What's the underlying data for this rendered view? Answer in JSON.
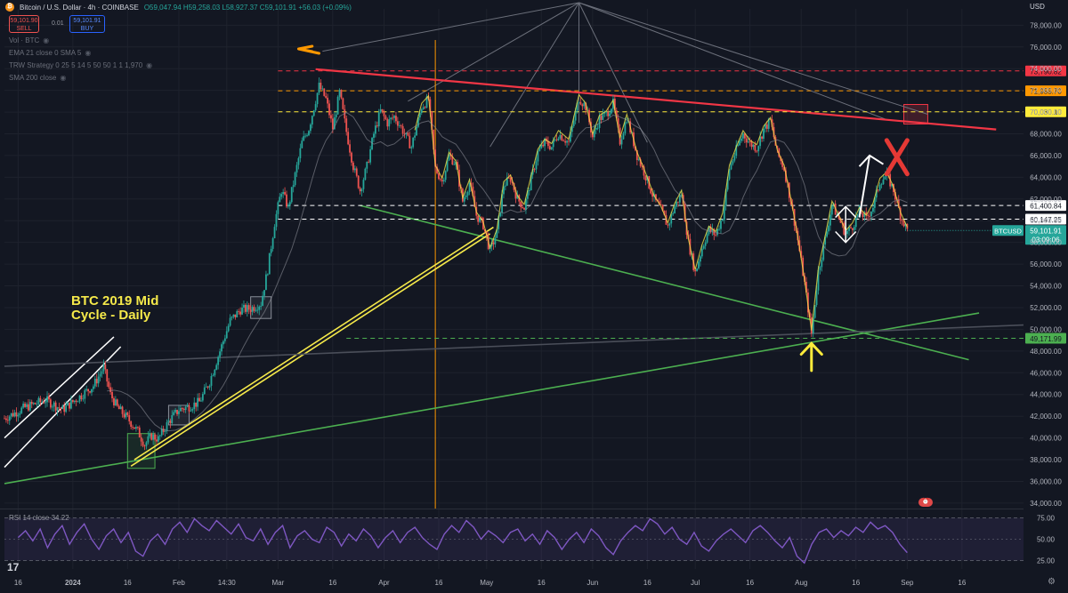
{
  "header": {
    "symbol_title": "Bitcoin / U.S. Dollar · 4h · COINBASE",
    "ohlc": {
      "o": "O59,047.94",
      "h": "H59,258.03",
      "l": "L58,927.37",
      "c": "C59,101.91",
      "chg": "+56.03 (+0.09%)"
    },
    "sell_price": "59,101.90",
    "sell_label": "SELL",
    "buy_price": "59,101.91",
    "buy_label": "BUY",
    "spread": "0.01",
    "currency": "USD"
  },
  "indicators": [
    "Vol · BTC",
    "EMA 21 close 0 SMA 5",
    "TRW Strategy 0 25 5 14 5 50 50 1 1 1,970",
    "SMA 200 close"
  ],
  "annotation": {
    "line1": "BTC 2019 Mid",
    "line2": "Cycle - Daily"
  },
  "rsi_label": "RSI 14 close 34.22",
  "tv_logo": "17",
  "colors": {
    "background": "#131722",
    "up": "#26a69a",
    "down": "#ef5350",
    "red_level": "#f23645",
    "orange_level": "#ff9800",
    "yellow_level": "#ffeb3b",
    "green_trend": "#4caf50",
    "yellow_trend": "#f5e94a",
    "rsi": "#7e57c2"
  },
  "chart_data": {
    "type": "candlestick",
    "price_axis": {
      "ticks": [
        34000,
        36000,
        38000,
        40000,
        42000,
        44000,
        46000,
        48000,
        50000,
        52000,
        54000,
        56000,
        58000,
        60000,
        62000,
        64000,
        66000,
        68000,
        70000,
        72000,
        74000,
        76000,
        78000
      ],
      "tick_labels": [
        "34,000.00",
        "36,000.00",
        "38,000.00",
        "40,000.00",
        "42,000.00",
        "44,000.00",
        "46,000.00",
        "48,000.00",
        "50,000.00",
        "52,000.00",
        "54,000.00",
        "56,000.00",
        "58,000.00",
        "60,000.00",
        "62,000.00",
        "64,000.00",
        "66,000.00",
        "68,000.00",
        "70,000.00",
        "72,000.00",
        "74,000.00",
        "76,000.00",
        "78,000.00"
      ],
      "ylim": [
        33500,
        79500
      ]
    },
    "time_axis": {
      "labels": [
        "16",
        "2024",
        "16",
        "Feb",
        "14:30",
        "Mar",
        "16",
        "Apr",
        "16",
        "May",
        "16",
        "Jun",
        "16",
        "Jul",
        "16",
        "Aug",
        "16",
        "Sep",
        "16"
      ],
      "label_days": [
        -16,
        0,
        16,
        31,
        45,
        60,
        76,
        91,
        107,
        121,
        137,
        152,
        168,
        182,
        198,
        213,
        229,
        244,
        260
      ],
      "xlim": [
        -20,
        278
      ]
    },
    "levels": [
      {
        "value": 73790.82,
        "label": "73,790.82",
        "color": "#f23645"
      },
      {
        "value": 71955.7,
        "label": "71,955.70",
        "color": "#ff9800"
      },
      {
        "value": 70030.1,
        "label": "70,030.10",
        "color": "#ffeb3b"
      },
      {
        "value": 61400.84,
        "label": "61,400.84",
        "color": "#ffffff"
      },
      {
        "value": 60147.25,
        "label": "60,147.25",
        "color": "#ffffff"
      },
      {
        "value": 49171.99,
        "label": "49,171.99",
        "color": "#4caf50"
      }
    ],
    "current": {
      "value": 59101.91,
      "symbol": "BTCUSD",
      "price_label": "59,101.91",
      "countdown": "03:09:06"
    },
    "price_path": [
      [
        -20,
        41800
      ],
      [
        -14,
        42800
      ],
      [
        -8,
        43500
      ],
      [
        -3,
        42600
      ],
      [
        2,
        43800
      ],
      [
        6,
        44800
      ],
      [
        9,
        46500
      ],
      [
        11,
        44000
      ],
      [
        13,
        42800
      ],
      [
        16,
        41800
      ],
      [
        19,
        40600
      ],
      [
        21,
        39400
      ],
      [
        23,
        40200
      ],
      [
        25,
        39900
      ],
      [
        28,
        41500
      ],
      [
        31,
        42600
      ],
      [
        34,
        42900
      ],
      [
        37,
        43300
      ],
      [
        40,
        45200
      ],
      [
        43,
        48000
      ],
      [
        46,
        50800
      ],
      [
        49,
        51800
      ],
      [
        52,
        51900
      ],
      [
        55,
        52400
      ],
      [
        57,
        55500
      ],
      [
        59,
        59800
      ],
      [
        61,
        62800
      ],
      [
        63,
        61200
      ],
      [
        65,
        64200
      ],
      [
        67,
        67200
      ],
      [
        69,
        68500
      ],
      [
        72,
        72400
      ],
      [
        74,
        71200
      ],
      [
        76,
        68500
      ],
      [
        78,
        71800
      ],
      [
        80,
        68200
      ],
      [
        82,
        65000
      ],
      [
        84,
        62800
      ],
      [
        86,
        65000
      ],
      [
        88,
        68000
      ],
      [
        90,
        70100
      ],
      [
        92,
        69000
      ],
      [
        94,
        69600
      ],
      [
        96,
        68600
      ],
      [
        99,
        66800
      ],
      [
        102,
        70500
      ],
      [
        104,
        71200
      ],
      [
        106,
        64800
      ],
      [
        108,
        63600
      ],
      [
        110,
        66000
      ],
      [
        112,
        65200
      ],
      [
        114,
        61800
      ],
      [
        116,
        63500
      ],
      [
        118,
        60500
      ],
      [
        120,
        59600
      ],
      [
        122,
        57200
      ],
      [
        124,
        58900
      ],
      [
        126,
        63300
      ],
      [
        128,
        63900
      ],
      [
        130,
        62000
      ],
      [
        132,
        61200
      ],
      [
        134,
        63800
      ],
      [
        136,
        66300
      ],
      [
        138,
        67200
      ],
      [
        140,
        66800
      ],
      [
        142,
        68000
      ],
      [
        145,
        67200
      ],
      [
        148,
        71300
      ],
      [
        150,
        70500
      ],
      [
        152,
        67700
      ],
      [
        154,
        69400
      ],
      [
        156,
        69800
      ],
      [
        158,
        70800
      ],
      [
        160,
        67300
      ],
      [
        162,
        69500
      ],
      [
        165,
        66000
      ],
      [
        167,
        64500
      ],
      [
        170,
        62000
      ],
      [
        172,
        61000
      ],
      [
        174,
        59500
      ],
      [
        176,
        61300
      ],
      [
        178,
        62500
      ],
      [
        180,
        58000
      ],
      [
        182,
        55200
      ],
      [
        184,
        57500
      ],
      [
        186,
        59200
      ],
      [
        188,
        58700
      ],
      [
        190,
        60400
      ],
      [
        192,
        64800
      ],
      [
        194,
        66500
      ],
      [
        196,
        68000
      ],
      [
        198,
        67100
      ],
      [
        200,
        66700
      ],
      [
        202,
        68400
      ],
      [
        204,
        69200
      ],
      [
        206,
        66200
      ],
      [
        208,
        64800
      ],
      [
        210,
        61700
      ],
      [
        212,
        58200
      ],
      [
        214,
        54200
      ],
      [
        216,
        49600
      ],
      [
        218,
        55300
      ],
      [
        220,
        58300
      ],
      [
        222,
        61500
      ],
      [
        224,
        60200
      ],
      [
        226,
        58800
      ],
      [
        228,
        59500
      ],
      [
        230,
        60900
      ],
      [
        232,
        60200
      ],
      [
        234,
        61300
      ],
      [
        236,
        63600
      ],
      [
        238,
        64200
      ],
      [
        240,
        62800
      ],
      [
        242,
        60500
      ],
      [
        244,
        59101.91
      ]
    ],
    "trendlines": [
      {
        "name": "red-resistance",
        "color": "#f23645",
        "points": [
          [
            71,
            73950
          ],
          [
            270,
            68400
          ]
        ]
      },
      {
        "name": "green-descending",
        "color": "#4caf50",
        "points": [
          [
            84,
            61400
          ],
          [
            262,
            47200
          ]
        ]
      },
      {
        "name": "green-ascending",
        "color": "#4caf50",
        "points": [
          [
            -20,
            35800
          ],
          [
            265,
            51500
          ]
        ]
      },
      {
        "name": "yellow-1",
        "color": "#f5e94a",
        "points": [
          [
            17,
            37400
          ],
          [
            122,
            58800
          ]
        ]
      },
      {
        "name": "yellow-2",
        "color": "#f5e94a",
        "points": [
          [
            18,
            38000
          ],
          [
            123,
            59400
          ]
        ]
      },
      {
        "name": "gray-long",
        "color": "#4a4e59",
        "points": [
          [
            -20,
            46600
          ],
          [
            278,
            50400
          ]
        ]
      }
    ],
    "rsi": {
      "label": "RSI 14 close",
      "value": 34.22,
      "ticks": [
        25,
        50,
        75
      ],
      "tick_labels": [
        "25.00",
        "50.00",
        "75.00"
      ],
      "ylim": [
        15,
        85
      ],
      "values": [
        52,
        60,
        48,
        62,
        40,
        56,
        66,
        44,
        58,
        68,
        50,
        38,
        54,
        62,
        46,
        58,
        36,
        30,
        48,
        56,
        44,
        62,
        70,
        58,
        74,
        66,
        60,
        72,
        64,
        56,
        68,
        52,
        48,
        62,
        44,
        58,
        66,
        40,
        54,
        60,
        50,
        46,
        64,
        58,
        42,
        56,
        48,
        62,
        54,
        40,
        52,
        60,
        46,
        58,
        64,
        52,
        44,
        38,
        56,
        66,
        58,
        72,
        64,
        50,
        60,
        54,
        46,
        58,
        62,
        48,
        56,
        44,
        60,
        52,
        38,
        50,
        58,
        46,
        62,
        54,
        40,
        32,
        48,
        58,
        66,
        60,
        74,
        68,
        56,
        64,
        50,
        44,
        58,
        42,
        36,
        48,
        56,
        62,
        54,
        46,
        60,
        66,
        58,
        48,
        40,
        52,
        30,
        22,
        44,
        58,
        62,
        52,
        60,
        54,
        64,
        58,
        70,
        62,
        66,
        58,
        44,
        34.22
      ]
    }
  }
}
